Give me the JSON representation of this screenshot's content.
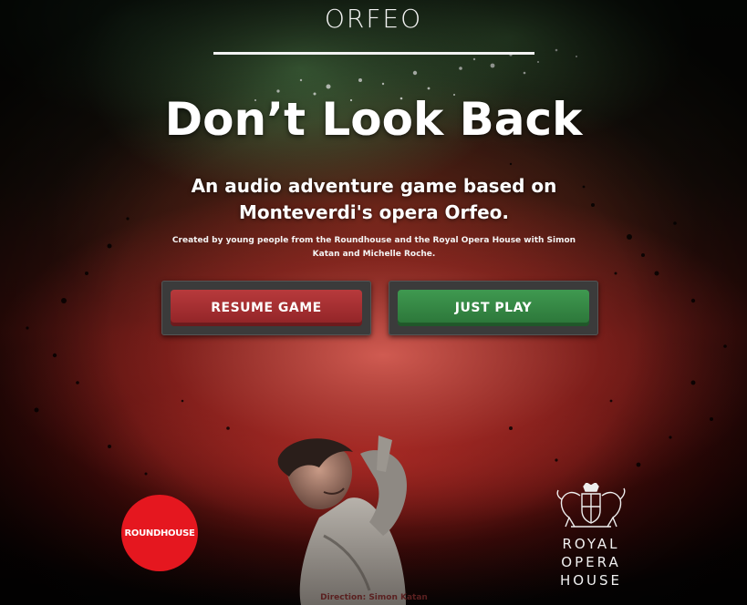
{
  "app": {
    "title": "ORFEO"
  },
  "hero": {
    "headline": "Don’t Look Back",
    "tagline": "An audio adventure game based on Monteverdi's opera Orfeo.",
    "credits": "Created by young people from the Roundhouse and the Royal Opera House with Simon Katan and Michelle Roche."
  },
  "actions": {
    "resume_label": "RESUME GAME",
    "play_label": "JUST PLAY"
  },
  "footer": {
    "direction_credit": "Direction: Simon Katan",
    "roundhouse_logo_text": "ROUNDHOUSE",
    "roh_logo_lines": [
      "ROYAL",
      "OPERA",
      "HOUSE"
    ]
  },
  "colors": {
    "resume": "#a02e31",
    "play": "#35864a",
    "roundhouse": "#e5171f"
  }
}
